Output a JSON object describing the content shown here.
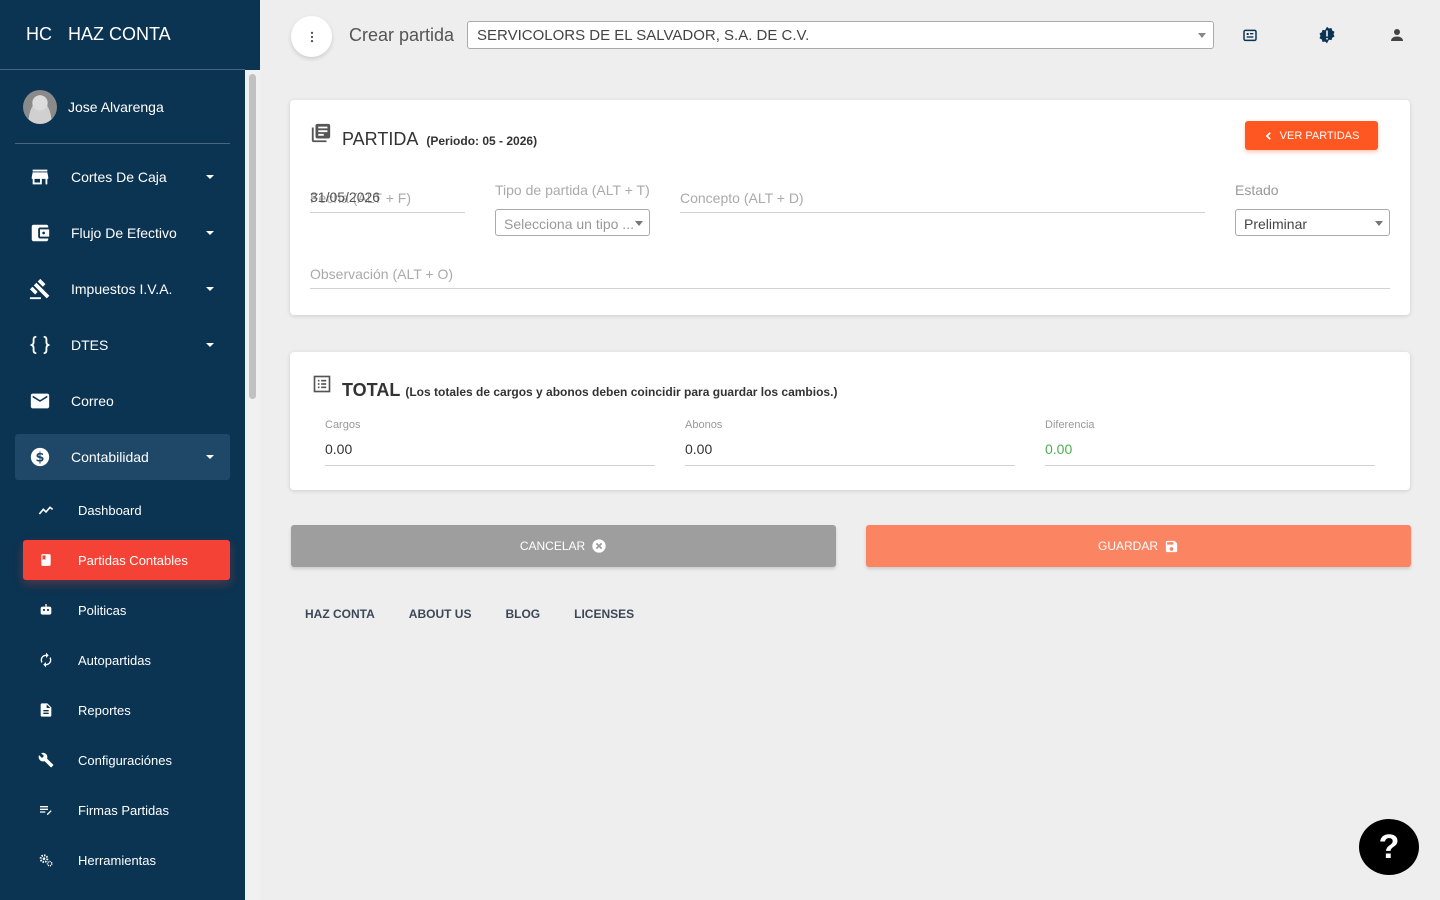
{
  "brand": {
    "mini": "HC",
    "name": "HAZ CONTA"
  },
  "user": {
    "name": "Jose Alvarenga"
  },
  "nav": [
    {
      "label": "Cortes De Caja",
      "icon": "store-icon"
    },
    {
      "label": "Flujo De Efectivo",
      "icon": "wallet-icon"
    },
    {
      "label": "Impuestos I.V.A.",
      "icon": "gavel-icon"
    },
    {
      "label": "DTES",
      "icon": "braces-icon"
    },
    {
      "label": "Correo",
      "icon": "mail-icon"
    },
    {
      "label": "Contabilidad",
      "icon": "dollar-circle-icon"
    }
  ],
  "subnav": [
    {
      "label": "Dashboard",
      "icon": "trending-icon"
    },
    {
      "label": "Partidas Contables",
      "icon": "book-icon"
    },
    {
      "label": "Politicas",
      "icon": "robot-icon"
    },
    {
      "label": "Autopartidas",
      "icon": "autorenew-icon"
    },
    {
      "label": "Reportes",
      "icon": "file-icon"
    },
    {
      "label": "Configuraciónes",
      "icon": "wrench-icon"
    },
    {
      "label": "Firmas Partidas",
      "icon": "sign-icon"
    },
    {
      "label": "Herramientas",
      "icon": "gears-icon"
    }
  ],
  "topbar": {
    "title": "Crear partida",
    "company": "SERVICOLORS DE EL SALVADOR, S.A. DE C.V."
  },
  "partida": {
    "title": "PARTIDA",
    "period": "(Periodo: 05 - 2026)",
    "ver_button": "VER PARTIDAS",
    "fecha_label": "Fecha (ALT + F)",
    "fecha_value": "31/05/2026",
    "tipo_label": "Tipo de partida (ALT + T)",
    "tipo_placeholder": "Selecciona un tipo ...",
    "concepto_label": "Concepto (ALT + D)",
    "estado_label": "Estado",
    "estado_value": "Preliminar",
    "observacion_label": "Observación (ALT + O)"
  },
  "total": {
    "title": "TOTAL",
    "note": "(Los totales de cargos y abonos deben coincidir para guardar los cambios.)",
    "cargos_label": "Cargos",
    "cargos_value": "0.00",
    "abonos_label": "Abonos",
    "abonos_value": "0.00",
    "diferencia_label": "Diferencia",
    "diferencia_value": "0.00"
  },
  "actions": {
    "cancel": "CANCELAR",
    "save": "GUARDAR"
  },
  "footer": [
    "HAZ CONTA",
    "ABOUT US",
    "BLOG",
    "LICENSES"
  ],
  "help": "?",
  "colors": {
    "sidebar": "#0b3352",
    "accent": "#f44336",
    "orange": "#ff5722",
    "save": "#fb8462",
    "success": "#4caf50"
  }
}
